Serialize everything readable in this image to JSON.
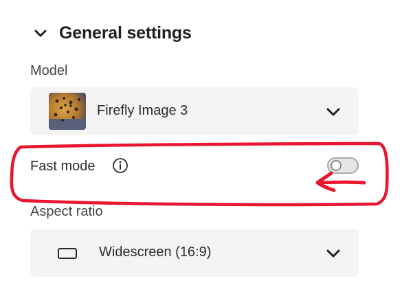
{
  "general": {
    "title": "General settings",
    "expand_icon": "chevron-down-icon"
  },
  "model": {
    "label": "Model",
    "value": "Firefly Image 3",
    "thumbnail_icon": "leopard-thumbnail",
    "dropdown_icon": "chevron-down-icon"
  },
  "fast_mode": {
    "label": "Fast mode",
    "info_icon": "info-icon",
    "enabled": false
  },
  "aspect_ratio": {
    "label": "Aspect ratio",
    "value": "Widescreen (16:9)",
    "shape_icon": "widescreen-icon",
    "dropdown_icon": "chevron-down-icon"
  },
  "colors": {
    "annotation": "#e8162f",
    "picker_bg": "#f4f4f4",
    "text": "#2c2c2c"
  }
}
